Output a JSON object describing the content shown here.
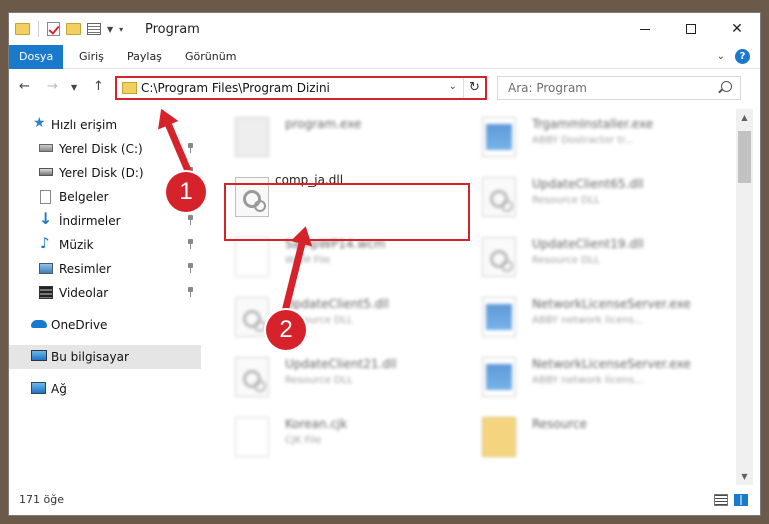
{
  "window": {
    "title": "Program",
    "accent": "#1979ca"
  },
  "ribbon": {
    "tabs": [
      {
        "label": "Dosya",
        "active": true
      },
      {
        "label": "Giriş"
      },
      {
        "label": "Paylaş"
      },
      {
        "label": "Görünüm"
      }
    ],
    "help_label": "?"
  },
  "address": {
    "path": "C:\\Program Files\\Program Dizini",
    "refresh_icon": "refresh-icon"
  },
  "search": {
    "placeholder": "Ara: Program"
  },
  "sidebar": {
    "items": [
      {
        "label": "Hızlı erişim",
        "icon": "star-icon"
      },
      {
        "label": "Yerel Disk (C:)",
        "icon": "drive-icon",
        "pinned": true
      },
      {
        "label": "Yerel Disk (D:)",
        "icon": "drive-icon",
        "pinned": true
      },
      {
        "label": "Belgeler",
        "icon": "documents-icon",
        "pinned": true
      },
      {
        "label": "İndirmeler",
        "icon": "download-icon",
        "pinned": true
      },
      {
        "label": "Müzik",
        "icon": "music-icon",
        "pinned": true
      },
      {
        "label": "Resimler",
        "icon": "pictures-icon",
        "pinned": true
      },
      {
        "label": "Videolar",
        "icon": "videos-icon",
        "pinned": true
      },
      {
        "label": "OneDrive",
        "icon": "cloud-icon"
      },
      {
        "label": "Bu bilgisayar",
        "icon": "computer-icon",
        "selected": true
      },
      {
        "label": "Ağ",
        "icon": "network-icon"
      }
    ]
  },
  "files": [
    {
      "name": "program.exe",
      "sub": "",
      "thumb": "exe",
      "blurred": true
    },
    {
      "name": "TrgammInstaller.exe",
      "sub": "ABBY Dostractor tr...",
      "thumb": "app",
      "blurred": true
    },
    {
      "name": "comp_ja.dll",
      "sub": "",
      "thumb": "dll",
      "blurred": false
    },
    {
      "name": "UpdateClient65.dll",
      "sub": "Resource DLL",
      "thumb": "dll",
      "blurred": true
    },
    {
      "name": "SampWP14.wcm",
      "sub": "WCM File",
      "thumb": "page",
      "blurred": true
    },
    {
      "name": "UpdateClient19.dll",
      "sub": "Resource DLL",
      "thumb": "dll",
      "blurred": true
    },
    {
      "name": "UpdateClient5.dll",
      "sub": "Resource DLL",
      "thumb": "dll",
      "blurred": true
    },
    {
      "name": "NetworkLicenseServer.exe",
      "sub": "ABBY network licens...",
      "thumb": "app",
      "blurred": true
    },
    {
      "name": "UpdateClient21.dll",
      "sub": "Resource DLL",
      "thumb": "dll",
      "blurred": true
    },
    {
      "name": "NetworkLicenseServer.exe",
      "sub": "ABBY network licens...",
      "thumb": "app",
      "blurred": true
    },
    {
      "name": "Korean.cjk",
      "sub": "CJK File",
      "thumb": "page",
      "blurred": true
    },
    {
      "name": "Resource",
      "sub": "",
      "thumb": "folder",
      "blurred": true
    }
  ],
  "status": {
    "count": "171 öğe"
  },
  "annotations": {
    "step1": "1",
    "step2": "2",
    "color": "#d6222a"
  }
}
